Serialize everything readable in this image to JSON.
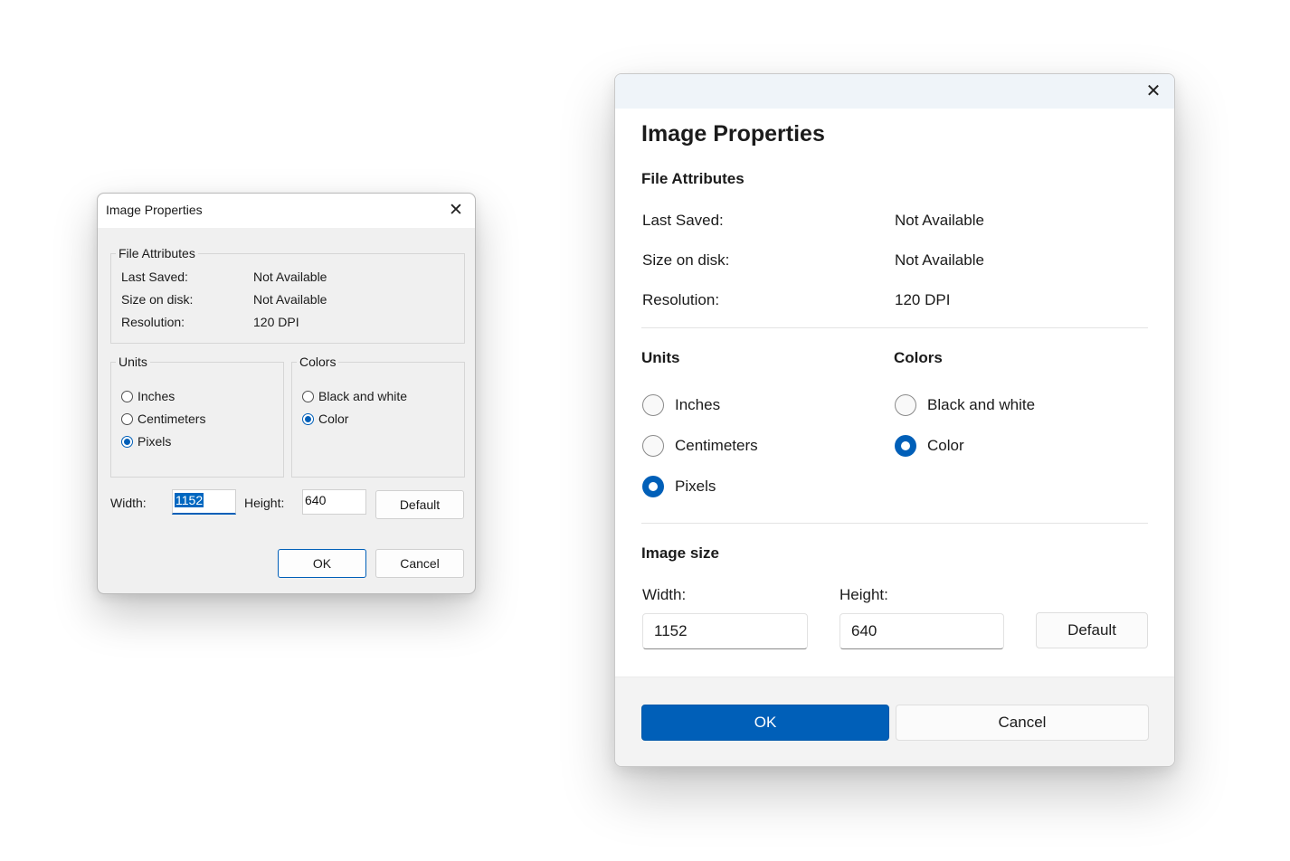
{
  "classic": {
    "title": "Image Properties",
    "close_icon": "close-icon",
    "file_attributes": {
      "legend": "File Attributes",
      "rows": [
        {
          "label": "Last Saved:",
          "value": "Not Available"
        },
        {
          "label": "Size on disk:",
          "value": "Not Available"
        },
        {
          "label": "Resolution:",
          "value": "120 DPI"
        }
      ]
    },
    "units": {
      "legend": "Units",
      "options": [
        "Inches",
        "Centimeters",
        "Pixels"
      ],
      "selected": "Pixels"
    },
    "colors": {
      "legend": "Colors",
      "options": [
        "Black and white",
        "Color"
      ],
      "selected": "Color"
    },
    "width_label": "Width:",
    "width_value": "1152",
    "height_label": "Height:",
    "height_value": "640",
    "default_label": "Default",
    "ok_label": "OK",
    "cancel_label": "Cancel"
  },
  "modern": {
    "title": "Image Properties",
    "close_icon": "close-icon",
    "file_attributes": {
      "heading": "File Attributes",
      "rows": [
        {
          "label": "Last Saved:",
          "value": "Not Available"
        },
        {
          "label": "Size on disk:",
          "value": "Not Available"
        },
        {
          "label": "Resolution:",
          "value": "120 DPI"
        }
      ]
    },
    "units": {
      "heading": "Units",
      "options": [
        "Inches",
        "Centimeters",
        "Pixels"
      ],
      "selected": "Pixels"
    },
    "colors": {
      "heading": "Colors",
      "options": [
        "Black and white",
        "Color"
      ],
      "selected": "Color"
    },
    "image_size": {
      "heading": "Image size",
      "width_label": "Width:",
      "width_value": "1152",
      "height_label": "Height:",
      "height_value": "640"
    },
    "default_label": "Default",
    "ok_label": "OK",
    "cancel_label": "Cancel"
  },
  "accent_color": "#005fb8"
}
